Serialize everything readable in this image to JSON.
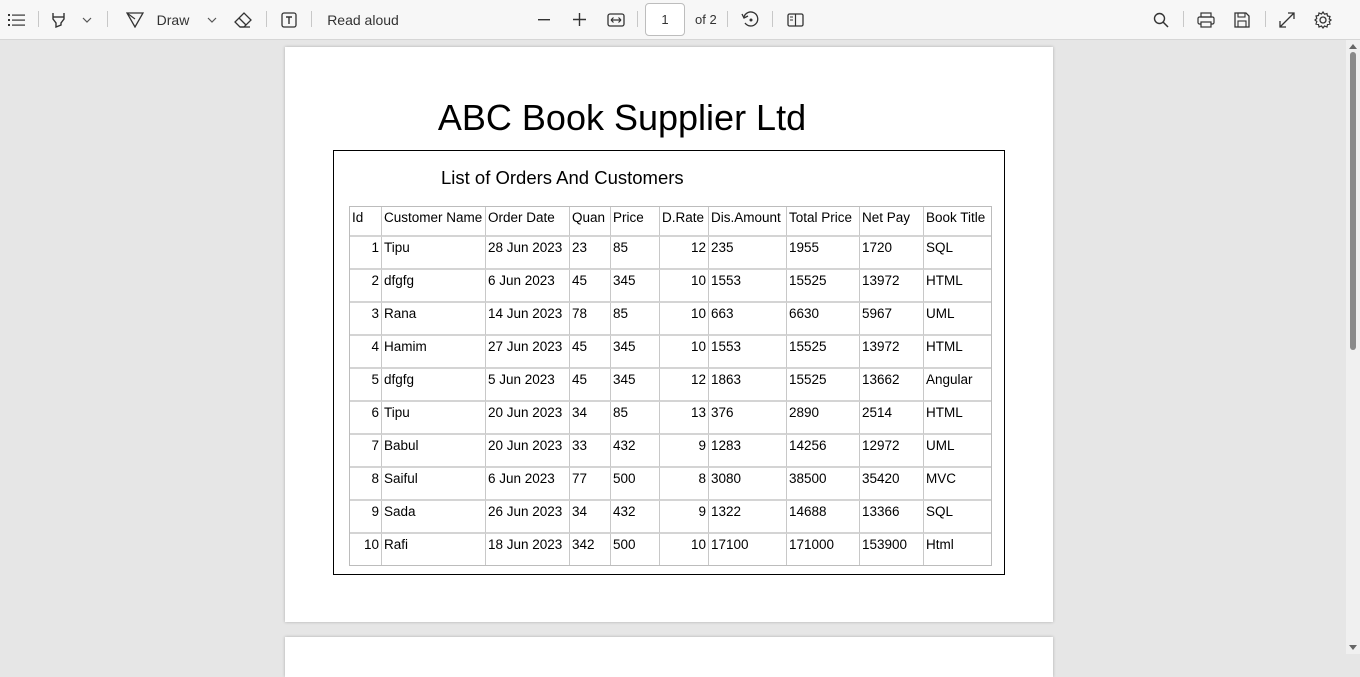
{
  "toolbar": {
    "contents_icon": "contents-list-icon",
    "highlight_icon": "highlighter-icon",
    "draw_label": "Draw",
    "read_aloud_label": "Read aloud",
    "current_page": "1",
    "page_total": "of 2"
  },
  "document": {
    "title": "ABC Book Supplier Ltd",
    "subtitle": "List of Orders And Customers",
    "columns": [
      "Id",
      "Customer Name",
      "Order Date",
      "Quan",
      "Price",
      "D.Rate",
      "Dis.Amount",
      "Total Price",
      "Net Pay",
      "Book Title"
    ],
    "rows": [
      [
        "1",
        "Tipu",
        "28 Jun 2023",
        "23",
        "85",
        "12",
        "235",
        "1955",
        "1720",
        "SQL"
      ],
      [
        "2",
        "dfgfg",
        "6 Jun 2023",
        "45",
        "345",
        "10",
        "1553",
        "15525",
        "13972",
        "HTML"
      ],
      [
        "3",
        "Rana",
        "14 Jun 2023",
        "78",
        "85",
        "10",
        "663",
        "6630",
        "5967",
        "UML"
      ],
      [
        "4",
        "Hamim",
        "27 Jun 2023",
        "45",
        "345",
        "10",
        "1553",
        "15525",
        "13972",
        "HTML"
      ],
      [
        "5",
        "dfgfg",
        "5 Jun 2023",
        "45",
        "345",
        "12",
        "1863",
        "15525",
        "13662",
        "Angular"
      ],
      [
        "6",
        "Tipu",
        "20 Jun 2023",
        "34",
        "85",
        "13",
        "376",
        "2890",
        "2514",
        "HTML"
      ],
      [
        "7",
        "Babul",
        "20 Jun 2023",
        "33",
        "432",
        "9",
        "1283",
        "14256",
        "12972",
        "UML"
      ],
      [
        "8",
        "Saiful",
        "6 Jun 2023",
        "77",
        "500",
        "8",
        "3080",
        "38500",
        "35420",
        "MVC"
      ],
      [
        "9",
        "Sada",
        "26 Jun 2023",
        "34",
        "432",
        "9",
        "1322",
        "14688",
        "13366",
        "SQL"
      ],
      [
        "10",
        "Rafi",
        "18 Jun 2023",
        "342",
        "500",
        "10",
        "17100",
        "171000",
        "153900",
        "Html"
      ]
    ]
  }
}
